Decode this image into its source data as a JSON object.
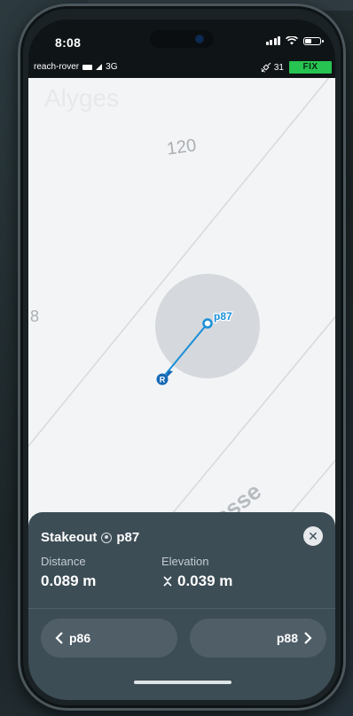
{
  "status_bar": {
    "time": "8:08"
  },
  "rover_bar": {
    "name": "reach-rover",
    "network": "3G",
    "satellites": "31",
    "fix_status": "FIX"
  },
  "map": {
    "place_label": "Alyges",
    "height_label": "120",
    "edge_label": "8",
    "street_label": "asse",
    "point_label": "p87",
    "rover_marker": "R"
  },
  "stakeout": {
    "title": "Stakeout",
    "point": "p87",
    "distance_label": "Distance",
    "distance_value": "0.089 m",
    "elevation_label": "Elevation",
    "elevation_value": "0.039 m",
    "prev_label": "p86",
    "next_label": "p88"
  }
}
